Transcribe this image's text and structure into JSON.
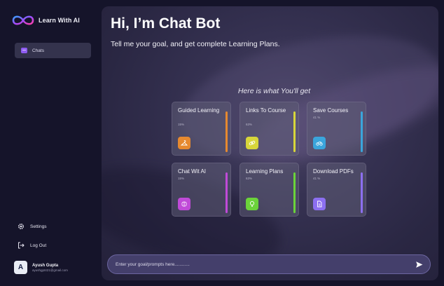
{
  "brand": {
    "name": "Learn With AI",
    "logo_icon": "infinity-logo-icon"
  },
  "sidebar": {
    "active": {
      "label": "Chats",
      "icon": "chat-icon"
    },
    "settings": {
      "label": "Settings",
      "icon": "gear-icon"
    },
    "logout": {
      "label": "Log Out",
      "icon": "logout-icon"
    },
    "user": {
      "initial": "A",
      "name": "Ayush Gupta",
      "email": "ayushgpt421@gmail.com"
    }
  },
  "main": {
    "title": "Hi, I’m Chat Bot",
    "subtitle": "Tell me your goal, and get complete Learning Plans.",
    "section_title": "Here is what You'll get",
    "cards": [
      {
        "title": "Guided Learning",
        "pct": "15%",
        "progress": 0.15,
        "color": "#e6892f",
        "icon": "hanger-icon"
      },
      {
        "title": "Links To Course",
        "pct": "63%",
        "progress": 0.63,
        "color": "#d7d63a",
        "icon": "link-icon"
      },
      {
        "title": "Save Courses",
        "pct": "41 %",
        "progress": 0.41,
        "color": "#3aa5dc",
        "icon": "bike-icon"
      },
      {
        "title": "Chat Wit AI",
        "pct": "15%",
        "progress": 0.15,
        "color": "#c04ad8",
        "icon": "brain-icon"
      },
      {
        "title": "Learning Plans",
        "pct": "63%",
        "progress": 0.63,
        "color": "#6bd33a",
        "icon": "lightbulb-icon"
      },
      {
        "title": "Download PDFs",
        "pct": "41 %",
        "progress": 0.41,
        "color": "#8c6ff0",
        "icon": "document-icon"
      }
    ],
    "prompt": {
      "placeholder": "Enter your goal/prompts here............",
      "send_icon": "send-icon"
    }
  },
  "colors": {
    "accent": "#8e5cf0",
    "background": "#15142a",
    "panel": "#2f2b4a"
  }
}
